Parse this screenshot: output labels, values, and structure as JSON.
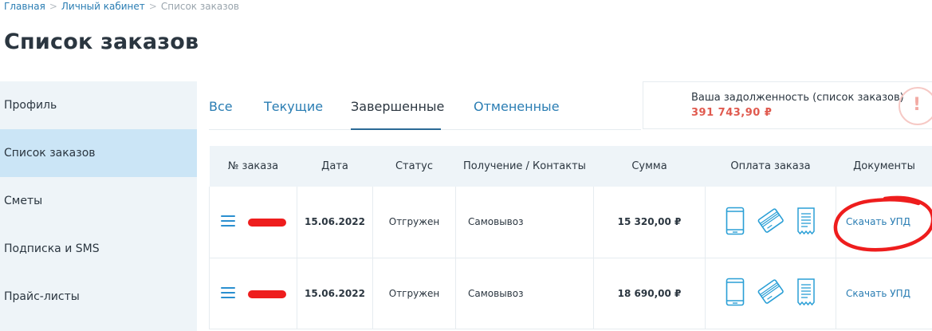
{
  "breadcrumb": {
    "items": [
      "Главная",
      "Личный кабинет",
      "Список заказов"
    ],
    "separator": ">"
  },
  "page": {
    "title": "Список заказов"
  },
  "sidebar": {
    "items": [
      {
        "label": "Профиль"
      },
      {
        "label": "Список заказов",
        "active": true
      },
      {
        "label": "Сметы"
      },
      {
        "label": "Подписка и SMS"
      },
      {
        "label": "Прайс-листы"
      }
    ]
  },
  "tabs": [
    {
      "label": "Все"
    },
    {
      "label": "Текущие"
    },
    {
      "label": "Завершенные",
      "active": true
    },
    {
      "label": "Отмененные"
    }
  ],
  "debt": {
    "label": "Ваша задолженность (список заказов)",
    "amount": "391 743,90 ₽",
    "icon": "alert-icon",
    "icon_glyph": "!"
  },
  "table": {
    "headers": [
      "№ заказа",
      "Дата",
      "Статус",
      "Получение / Контакты",
      "Сумма",
      "Оплата заказа",
      "Документы"
    ],
    "rows": [
      {
        "date": "15.06.2022",
        "status": "Отгружен",
        "delivery": "Самовывоз",
        "sum": "15 320,00 ₽",
        "doc_link": "Скачать УПД"
      },
      {
        "date": "15.06.2022",
        "status": "Отгружен",
        "delivery": "Самовывоз",
        "sum": "18 690,00 ₽",
        "doc_link": "Скачать УПД"
      }
    ],
    "pay_icons": [
      "mobile-phone-icon",
      "credit-card-icon",
      "receipt-icon"
    ]
  },
  "colors": {
    "accent": "#2a7db3",
    "icon_blue": "#2a9fd6",
    "debt_red": "#e05a4f",
    "status_green": "#4caf50",
    "sidebar_bg": "#eef4f8",
    "sidebar_active": "#cbe5f6",
    "annotation_red": "#ee1d1d"
  }
}
